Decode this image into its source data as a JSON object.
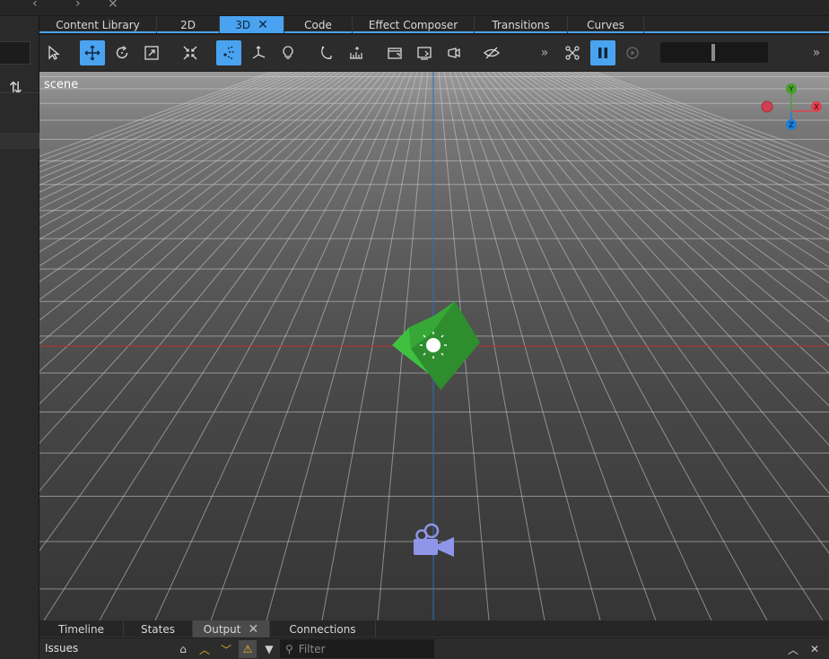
{
  "tabs": [
    {
      "label": "Content Library",
      "active": false
    },
    {
      "label": "2D",
      "active": false
    },
    {
      "label": "3D",
      "active": true,
      "closable": true
    },
    {
      "label": "Code",
      "active": false
    },
    {
      "label": "Effect Composer",
      "active": false
    },
    {
      "label": "Transitions",
      "active": false
    },
    {
      "label": "Curves",
      "active": false
    }
  ],
  "toolbar": {
    "tools": [
      {
        "icon": "select-arrow-icon",
        "active": false
      },
      {
        "icon": "move-icon",
        "active": true
      },
      {
        "icon": "rotate-icon",
        "active": false
      },
      {
        "icon": "scale-icon",
        "active": false
      },
      {
        "icon": "fit-selection-icon",
        "active": false
      },
      {
        "icon": "local-orientation-icon",
        "active": true
      },
      {
        "icon": "pivot-icon",
        "active": false
      },
      {
        "icon": "light-bulb-icon",
        "active": false
      },
      {
        "icon": "snap-rotation-icon",
        "active": false
      },
      {
        "icon": "grid-ruler-icon",
        "active": false
      },
      {
        "icon": "camera-view-icon",
        "active": false
      },
      {
        "icon": "screen-view-icon",
        "active": false
      },
      {
        "icon": "camera-speed-icon",
        "active": false
      },
      {
        "icon": "visibility-toggle-icon",
        "active": false
      },
      {
        "icon": "more-chevrons-icon",
        "active": false
      },
      {
        "icon": "particles-icon",
        "active": false
      },
      {
        "icon": "pause-icon",
        "active": true
      },
      {
        "icon": "playback-icon",
        "active": false
      },
      {
        "icon": "more-chevrons-icon",
        "active": false
      }
    ],
    "speed_level": 0.49
  },
  "viewport": {
    "scene_label": "scene",
    "gizmo": {
      "x": "X",
      "y": "Y",
      "z": "Z"
    },
    "colors": {
      "x_axis": "#e0404f",
      "y_axis": "#4aa02c",
      "z_axis": "#1a80d8",
      "model": "#2fa52f",
      "camera": "#8f95e8"
    }
  },
  "bottom_tabs": [
    {
      "label": "Timeline",
      "active": false
    },
    {
      "label": "States",
      "active": false
    },
    {
      "label": "Output",
      "active": true,
      "closable": true
    },
    {
      "label": "Connections",
      "active": false
    }
  ],
  "issues": {
    "label": "Issues",
    "filter_placeholder": "Filter"
  },
  "left_panel": {
    "sort_icon": "⇅"
  }
}
